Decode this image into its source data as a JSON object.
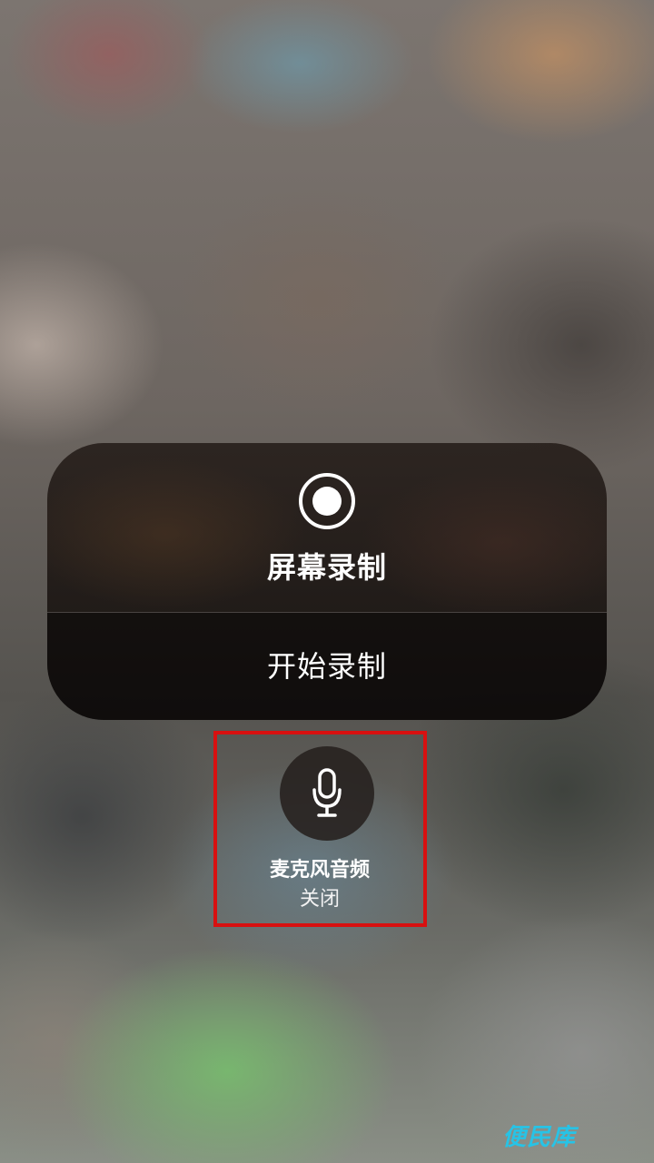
{
  "screen_recording": {
    "title": "屏幕录制",
    "start_label": "开始录制",
    "icon": "record-icon"
  },
  "microphone": {
    "label": "麦克风音频",
    "status": "关闭",
    "icon": "microphone-icon"
  },
  "watermark": {
    "text": "便民库"
  },
  "colors": {
    "highlight_border": "#d81010",
    "watermark": "#27c3e6",
    "panel_background": "#16120f"
  }
}
